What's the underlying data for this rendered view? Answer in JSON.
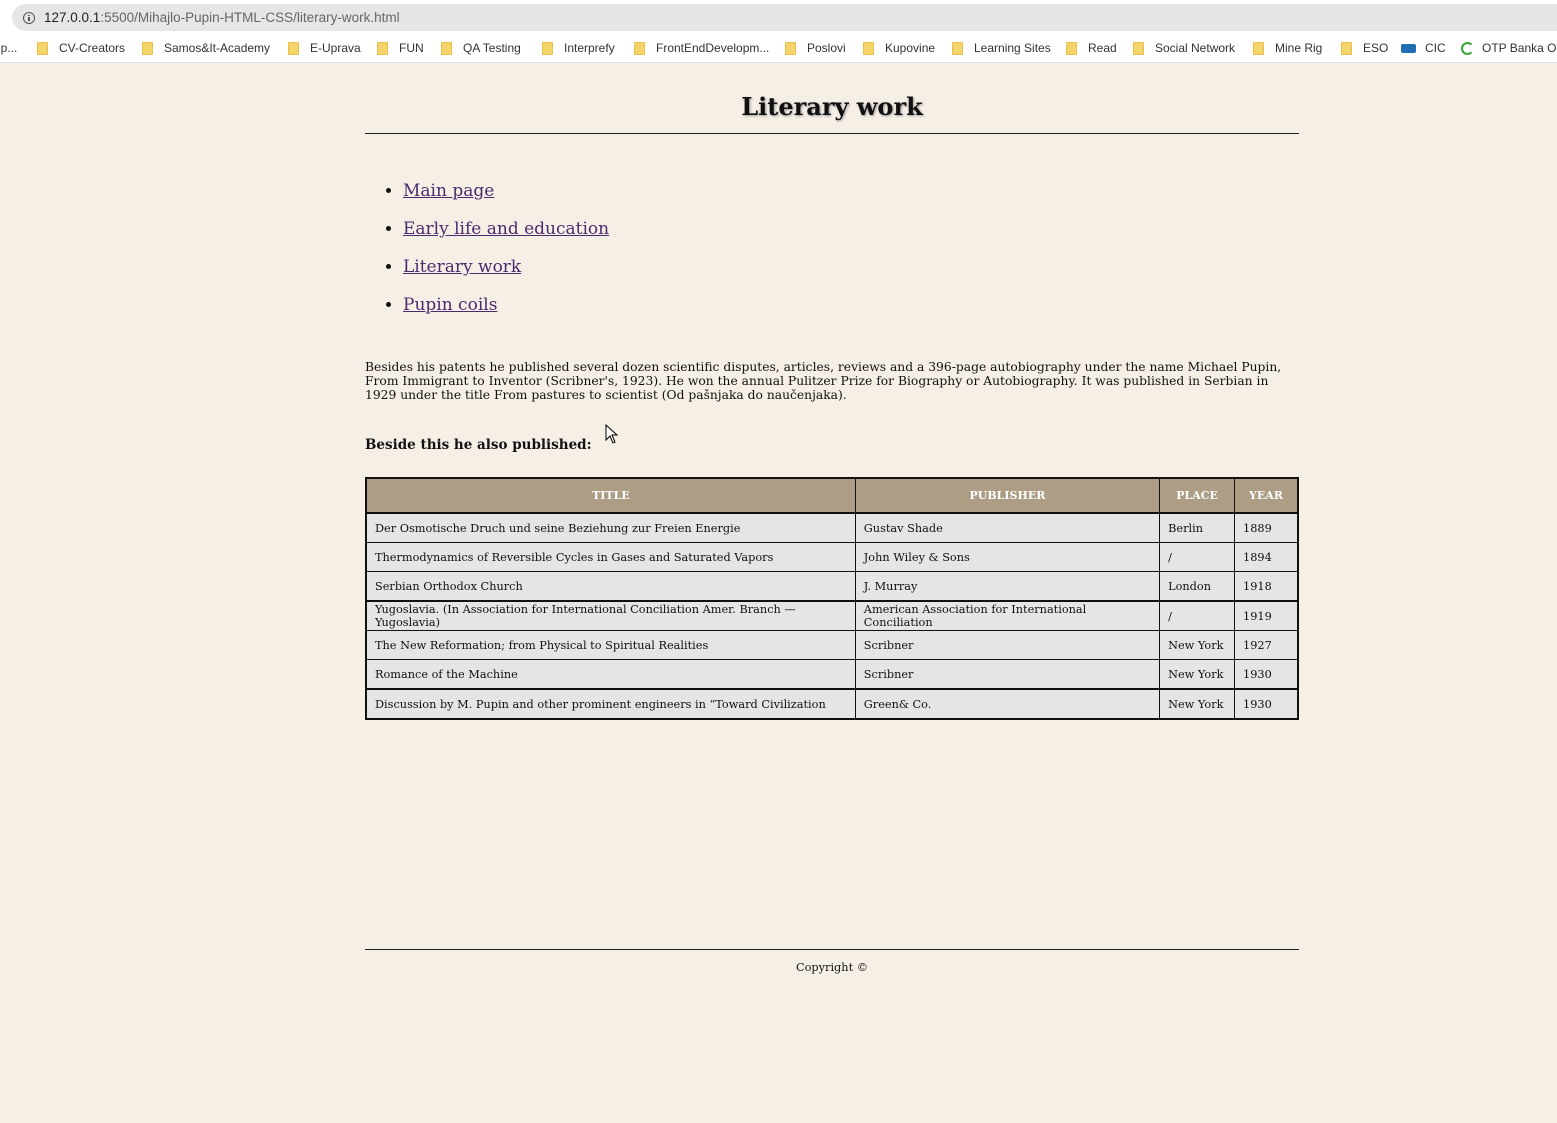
{
  "browser": {
    "url_host": "127.0.0.1",
    "url_path": ":5500/Mihajlo-Pupin-HTML-CSS/literary-work.html",
    "bookmarks": [
      {
        "label": "np..."
      },
      {
        "label": "CV-Creators"
      },
      {
        "label": "Samos&It-Academy"
      },
      {
        "label": "E-Uprava"
      },
      {
        "label": "FUN"
      },
      {
        "label": "QA Testing"
      },
      {
        "label": "Interprefy"
      },
      {
        "label": "FrontEndDevelopm..."
      },
      {
        "label": "Poslovi"
      },
      {
        "label": "Kupovine"
      },
      {
        "label": "Learning Sites"
      },
      {
        "label": "Read"
      },
      {
        "label": "Social Network"
      },
      {
        "label": "Mine Rig"
      },
      {
        "label": "ESO"
      },
      {
        "label": "CIC"
      },
      {
        "label": "OTP Banka Or"
      }
    ]
  },
  "page": {
    "title": "Literary work",
    "nav": [
      {
        "label": "Main page"
      },
      {
        "label": "Early life and education"
      },
      {
        "label": "Literary work"
      },
      {
        "label": "Pupin coils"
      }
    ],
    "intro": "Besides his patents he published several dozen scientific disputes, articles, reviews and a 396-page autobiography under the name Michael Pupin, From Immigrant to Inventor (Scribner's, 1923). He won the annual Pulitzer Prize for Biography or Autobiography. It was published in Serbian in 1929 under the title From pastures to scientist (Od pašnjaka do naučenjaka).",
    "also_heading": "Beside this he also published:",
    "table": {
      "headers": [
        "Title",
        "Publisher",
        "Place",
        "Year"
      ],
      "rows": [
        [
          "Der Osmotische Druch und seine Beziehung zur Freien Energie",
          "Gustav Shade",
          "Berlin",
          "1889"
        ],
        [
          "Thermodynamics of Reversible Cycles in Gases and Saturated Vapors",
          "John Wiley & Sons",
          "/",
          "1894"
        ],
        [
          "Serbian Orthodox Church",
          "J. Murray",
          "London",
          "1918"
        ],
        [
          "Yugoslavia. (In Association for International Conciliation Amer. Branch —Yugoslavia)",
          "American Association for International Conciliation",
          "/",
          "1919"
        ],
        [
          "The New Reformation; from Physical to Spiritual Realities",
          "Scribner",
          "New York",
          "1927"
        ],
        [
          "Romance of the Machine",
          "Scribner",
          "New York",
          "1930"
        ],
        [
          "Discussion by M. Pupin and other prominent engineers in “Toward Civilization",
          "Green& Co.",
          "New York",
          "1930"
        ]
      ]
    },
    "footer": "Copyright ©"
  }
}
